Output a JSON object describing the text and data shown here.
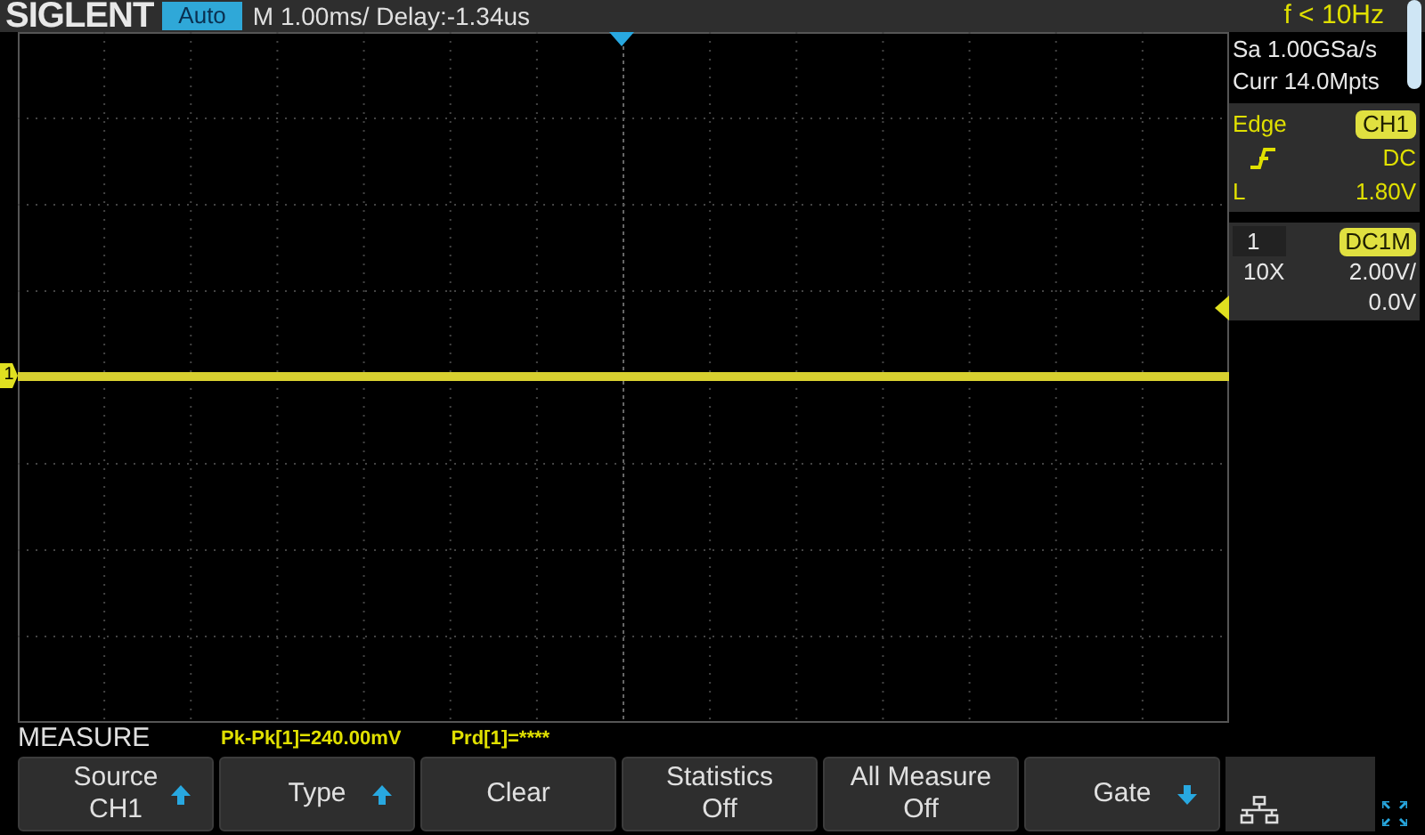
{
  "header": {
    "logo": "SIGLENT",
    "mode": "Auto",
    "timebase": "M 1.00ms/ Delay:-1.34us",
    "frequency": "f < 10Hz"
  },
  "acquisition": {
    "sample_rate": "Sa 1.00GSa/s",
    "memory": "Curr 14.0Mpts"
  },
  "trigger": {
    "type": "Edge",
    "source": "CH1",
    "coupling": "DC",
    "level_label": "L",
    "level": "1.80V"
  },
  "channel": {
    "number": "1",
    "coupling": "DC1M",
    "probe": "10X",
    "scale": "2.00V/",
    "offset": "0.0V"
  },
  "trace": {
    "marker": "1"
  },
  "measure": {
    "title": "MEASURE",
    "readings": [
      "Pk-Pk[1]=240.00mV",
      "Prd[1]=****"
    ]
  },
  "softkeys": [
    {
      "kind": "up",
      "label": "Source",
      "value": "CH1"
    },
    {
      "kind": "up",
      "label": "Type"
    },
    {
      "kind": "plain",
      "label": "Clear"
    },
    {
      "kind": "plain",
      "label": "Statistics",
      "value": "Off"
    },
    {
      "kind": "plain",
      "label": "All Measure",
      "value": "Off"
    },
    {
      "kind": "down",
      "label": "Gate"
    },
    {
      "kind": "network"
    }
  ]
}
